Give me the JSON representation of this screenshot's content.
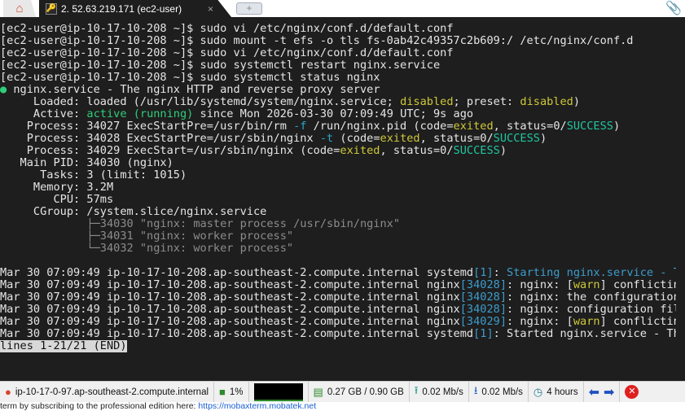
{
  "tab": {
    "title": "2. 52.63.219.171 (ec2-user)",
    "close": "×",
    "new": "+"
  },
  "colors": {
    "green": "#2fcf7a",
    "yellow": "#cfc83a",
    "cyan": "#2aa3c9",
    "bg": "#1e1e1e"
  },
  "terminal": {
    "lines": [
      [
        [
          "",
          "[ec2-user@ip-10-17-10-208 ~]$ sudo vi /etc/nginx/conf.d/default.conf"
        ]
      ],
      [
        [
          "",
          "[ec2-user@ip-10-17-10-208 ~]$ sudo mount -t efs -o tls fs-0ab42c49357c2b609:/ /etc/nginx/conf.d"
        ]
      ],
      [
        [
          "",
          "[ec2-user@ip-10-17-10-208 ~]$ sudo vi /etc/nginx/conf.d/default.conf"
        ]
      ],
      [
        [
          "",
          "[ec2-user@ip-10-17-10-208 ~]$ sudo systemctl restart nginx.service"
        ]
      ],
      [
        [
          "",
          "[ec2-user@ip-10-17-10-208 ~]$ sudo systemctl status nginx"
        ]
      ],
      [
        [
          "green",
          "●"
        ],
        [
          "",
          " nginx.service - The nginx HTTP and reverse proxy server"
        ]
      ],
      [
        [
          "",
          "     Loaded: loaded (/usr/lib/systemd/system/nginx.service; "
        ],
        [
          "yellow",
          "disabled"
        ],
        [
          "",
          "; preset: "
        ],
        [
          "yellow",
          "disabled"
        ],
        [
          "",
          ")"
        ]
      ],
      [
        [
          "",
          "     Active: "
        ],
        [
          "green",
          "active (running)"
        ],
        [
          "",
          " since Mon 2026-03-30 07:09:49 UTC; 9s ago"
        ]
      ],
      [
        [
          "",
          "    Process: 34027 ExecStartPre=/usr/bin/rm "
        ],
        [
          "cyan",
          "-f"
        ],
        [
          "",
          " /run/nginx.pid (code="
        ],
        [
          "yellow",
          "exited"
        ],
        [
          "",
          ", status=0/"
        ],
        [
          "teal",
          "SUCCESS"
        ],
        [
          "",
          ")"
        ]
      ],
      [
        [
          "",
          "    Process: 34028 ExecStartPre=/usr/sbin/nginx "
        ],
        [
          "cyan",
          "-t"
        ],
        [
          "",
          " (code="
        ],
        [
          "yellow",
          "exited"
        ],
        [
          "",
          ", status=0/"
        ],
        [
          "teal",
          "SUCCESS"
        ],
        [
          "",
          ")"
        ]
      ],
      [
        [
          "",
          "    Process: 34029 ExecStart=/usr/sbin/nginx (code="
        ],
        [
          "yellow",
          "exited"
        ],
        [
          "",
          ", status=0/"
        ],
        [
          "teal",
          "SUCCESS"
        ],
        [
          "",
          ")"
        ]
      ],
      [
        [
          "",
          "   Main PID: 34030 (nginx)"
        ]
      ],
      [
        [
          "",
          "      Tasks: 3 (limit: 1015)"
        ]
      ],
      [
        [
          "",
          "     Memory: 3.2M"
        ]
      ],
      [
        [
          "",
          "        CPU: 57ms"
        ]
      ],
      [
        [
          "",
          "     CGroup: /system.slice/nginx.service"
        ]
      ],
      [
        [
          "gray",
          "             ├─34030 \"nginx: master process /usr/sbin/nginx\""
        ]
      ],
      [
        [
          "gray",
          "             ├─34031 \"nginx: worker process\""
        ]
      ],
      [
        [
          "gray",
          "             └─34032 \"nginx: worker process\""
        ]
      ],
      [
        [
          "",
          ""
        ]
      ],
      [
        [
          "",
          "Mar 30 07:09:49 ip-10-17-10-208.ap-southeast-2.compute.internal systemd"
        ],
        [
          "blue",
          "[1]"
        ],
        [
          "",
          ": "
        ],
        [
          "blue",
          "Starting nginx.service - T"
        ],
        [
          "trunc",
          ">"
        ]
      ],
      [
        [
          "",
          "Mar 30 07:09:49 ip-10-17-10-208.ap-southeast-2.compute.internal nginx"
        ],
        [
          "blue",
          "[34028]"
        ],
        [
          "",
          ": nginx: ["
        ],
        [
          "yellow",
          "warn"
        ],
        [
          "",
          "] conflictin"
        ],
        [
          "trunc",
          ">"
        ]
      ],
      [
        [
          "",
          "Mar 30 07:09:49 ip-10-17-10-208.ap-southeast-2.compute.internal nginx"
        ],
        [
          "blue",
          "[34028]"
        ],
        [
          "",
          ": nginx: the configuration"
        ],
        [
          "trunc",
          ">"
        ]
      ],
      [
        [
          "",
          "Mar 30 07:09:49 ip-10-17-10-208.ap-southeast-2.compute.internal nginx"
        ],
        [
          "blue",
          "[34028]"
        ],
        [
          "",
          ": nginx: configuration fil"
        ],
        [
          "trunc",
          ">"
        ]
      ],
      [
        [
          "",
          "Mar 30 07:09:49 ip-10-17-10-208.ap-southeast-2.compute.internal nginx"
        ],
        [
          "blue",
          "[34029]"
        ],
        [
          "",
          ": nginx: ["
        ],
        [
          "yellow",
          "warn"
        ],
        [
          "",
          "] conflictin"
        ],
        [
          "trunc",
          ">"
        ]
      ],
      [
        [
          "",
          "Mar 30 07:09:49 ip-10-17-10-208.ap-southeast-2.compute.internal systemd"
        ],
        [
          "blue",
          "[1]"
        ],
        [
          "",
          ": Started nginx.service - Th"
        ],
        [
          "trunc",
          ">"
        ]
      ],
      [
        [
          "inv",
          "lines 1-21/21 (END)"
        ]
      ]
    ]
  },
  "status": {
    "host": "ip-10-17-0-97.ap-southeast-2.compute.internal",
    "cpu": "1%",
    "memory": "0.27 GB / 0.90 GB",
    "upload": "0.02 Mb/s",
    "download": "0.02 Mb/s",
    "uptime": "4 hours"
  },
  "footer": {
    "text": "term by subscribing to the professional edition here: ",
    "link": "https://mobaxterm.mobatek.net"
  }
}
